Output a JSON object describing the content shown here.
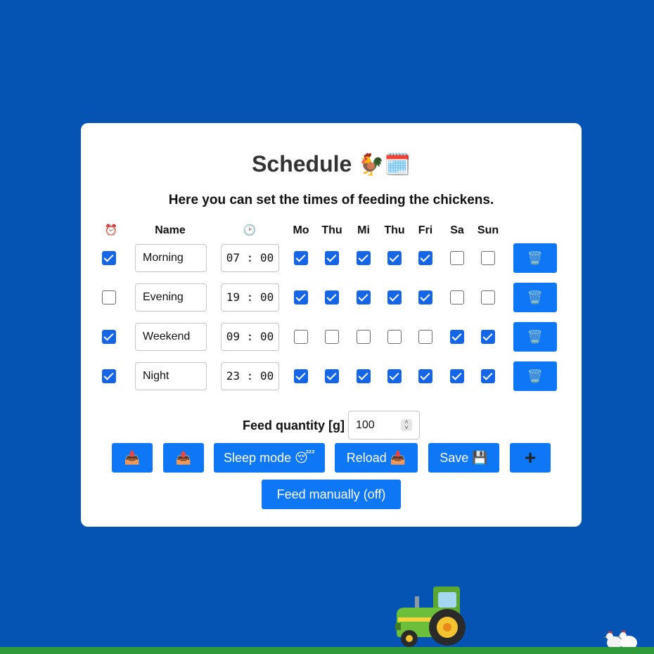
{
  "title": "Schedule",
  "title_emoji": "🐓🗓️",
  "subtitle": "Here you can set the times of feeding the chickens.",
  "headers": {
    "enabled_icon": "⏰",
    "name": "Name",
    "time_icon": "🕑",
    "days": [
      "Mo",
      "Thu",
      "Mi",
      "Thu",
      "Fri",
      "Sa",
      "Sun"
    ]
  },
  "rows": [
    {
      "enabled": true,
      "name": "Morning",
      "hour": "07",
      "minute": "00",
      "days": [
        true,
        true,
        true,
        true,
        true,
        false,
        false
      ]
    },
    {
      "enabled": false,
      "name": "Evening",
      "hour": "19",
      "minute": "00",
      "days": [
        true,
        true,
        true,
        true,
        true,
        false,
        false
      ]
    },
    {
      "enabled": true,
      "name": "Weekend",
      "hour": "09",
      "minute": "00",
      "days": [
        false,
        false,
        false,
        false,
        false,
        true,
        true
      ]
    },
    {
      "enabled": true,
      "name": "Night",
      "hour": "23",
      "minute": "00",
      "days": [
        true,
        true,
        true,
        true,
        true,
        true,
        true
      ]
    }
  ],
  "delete_icon": "🗑️",
  "feed_quantity": {
    "label": "Feed quantity [g]",
    "value": "100"
  },
  "buttons": {
    "download": "📥",
    "upload": "📤",
    "sleep_mode": "Sleep mode 😴",
    "reload": "Reload 📥",
    "save": "Save 💾",
    "add": "+",
    "feed_manually": "Feed manually (off)"
  },
  "colors": {
    "background": "#0554b3",
    "accent": "#0d77f5",
    "checkbox": "#1466e6",
    "ground": "#2e9a3a"
  }
}
